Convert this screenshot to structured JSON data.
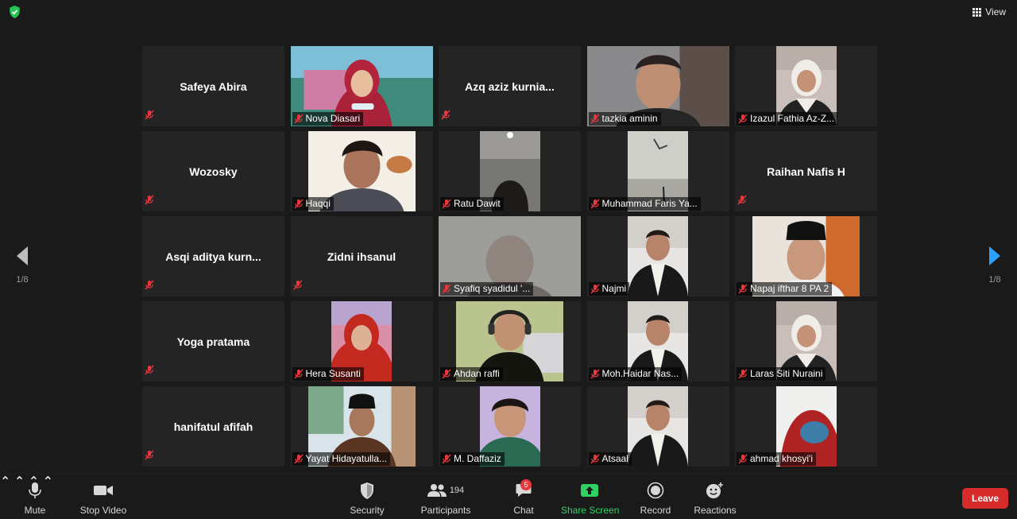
{
  "top": {
    "view_label": "View"
  },
  "pager": {
    "left": "1/8",
    "right": "1/8"
  },
  "participants": [
    {
      "name": "Safeya Abira",
      "video": false
    },
    {
      "name": "Nova Diasari",
      "video": true,
      "active": true,
      "scene": "woman-hijab-red"
    },
    {
      "name": "Azq aziz kurnia...",
      "video": false
    },
    {
      "name": "tazkia aminin",
      "video": true,
      "scene": "boy-close"
    },
    {
      "name": "Izazul Fathia Az-Z...",
      "video": true,
      "scene": "girl-white-hijab"
    },
    {
      "name": "Wozosky",
      "video": false
    },
    {
      "name": "Haqqi",
      "video": true,
      "scene": "boy-orange"
    },
    {
      "name": "Ratu Dawit",
      "video": true,
      "scene": "dark-room"
    },
    {
      "name": "Muhammad Faris Ya...",
      "video": true,
      "scene": "ceiling"
    },
    {
      "name": "Raihan Nafis H",
      "video": false
    },
    {
      "name": "Asqi aditya kurn...",
      "video": false
    },
    {
      "name": "Zidni ihsanul",
      "video": false
    },
    {
      "name": "Syafiq syadidul '...",
      "video": true,
      "scene": "grey-face"
    },
    {
      "name": "Najmi",
      "video": true,
      "scene": "boy-suit"
    },
    {
      "name": "Napaj ifthar 8 PA 2",
      "video": true,
      "scene": "boy-peci-orange"
    },
    {
      "name": "Yoga pratama",
      "video": false
    },
    {
      "name": "Hera Susanti",
      "video": true,
      "scene": "girl-red-hijab"
    },
    {
      "name": "Ahdan raffi",
      "video": true,
      "scene": "boy-headphones"
    },
    {
      "name": "Moh.Haidar Nas...",
      "video": true,
      "scene": "boy-suit"
    },
    {
      "name": "Laras Siti Nuraini",
      "video": true,
      "scene": "girl-white-hijab"
    },
    {
      "name": "hanifatul afifah",
      "video": false
    },
    {
      "name": "Yayat Hidayatulla...",
      "video": true,
      "scene": "man-batik"
    },
    {
      "name": "M. Daffaziz",
      "video": true,
      "scene": "boy-green"
    },
    {
      "name": "Atsaal",
      "video": true,
      "scene": "boy-suit"
    },
    {
      "name": "ahmad khosyi'i",
      "video": true,
      "scene": "masked"
    }
  ],
  "toolbar": {
    "mute": "Mute",
    "stop_video": "Stop Video",
    "security": "Security",
    "participants": "Participants",
    "participant_count": "194",
    "chat": "Chat",
    "chat_badge": "5",
    "share_screen": "Share Screen",
    "record": "Record",
    "reactions": "Reactions",
    "leave": "Leave"
  },
  "colors": {
    "active_speaker": "#e3e84b",
    "share_green": "#2fd163",
    "leave_red": "#d52b2b",
    "tile_bg": "#242424",
    "mute_red": "#e8373d"
  }
}
